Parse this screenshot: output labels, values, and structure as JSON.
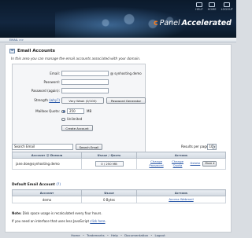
{
  "header": {
    "top_links": [
      {
        "label": "HELP",
        "icon": "help-icon"
      },
      {
        "label": "HOME",
        "icon": "home-icon"
      },
      {
        "label": "LOGOUT",
        "icon": "logout-icon"
      }
    ],
    "brand_mark": "c",
    "brand_name": "Panel",
    "brand_tagline": "Accelerated"
  },
  "breadcrumb": "EMAIL >>",
  "page": {
    "title": "Email Accounts",
    "intro": "In this area you can manage the email accounts associated with your domain."
  },
  "form": {
    "email_label": "Email:",
    "email_value": "",
    "domain_suffix": "@ synhosting.demo",
    "password_label": "Password:",
    "password_again_label": "Password (again):",
    "strength_label": "Strength",
    "strength_why": "(why?)",
    "strength_value": "Very Weak (0/100)",
    "generator_label": "Password Generator",
    "quota_label": "Mailbox Quota:",
    "quota_value": "250",
    "quota_unit": "MB",
    "unlimited_label": "Unlimited",
    "create_label": "Create Account"
  },
  "search": {
    "placeholder": "Search Email",
    "button_label": "Search Email",
    "rpp_label": "Results per page:",
    "rpp_value": "10"
  },
  "accounts_table": {
    "headers": {
      "account": "Account",
      "at": "@",
      "domain": "Domain",
      "usage": "Usage",
      "slash": "/",
      "quota": "Quota",
      "actions": "Actions"
    },
    "rows": [
      {
        "email": "jane.doe@synhosting.demo",
        "usage": "0 / 250 MB",
        "usage_fraction": 0,
        "change_password": "Change Password",
        "change_quota": "Change Quota",
        "delete": "Delete",
        "more": "More ▾"
      }
    ]
  },
  "default_account": {
    "title": "Default Email Account",
    "help": "(?)",
    "headers": {
      "account": "Account",
      "usage": "Usage",
      "actions": "Actions"
    },
    "row": {
      "account": "demo",
      "usage": "0 Bytes",
      "action": "Access Webmail"
    }
  },
  "notes": {
    "note_label": "Note:",
    "note_text": "Disk space usage is recalculated every four hours.",
    "js_prefix": "If you need an interface that uses less JavaScript",
    "js_link": "click here",
    "js_suffix": "."
  },
  "footer": {
    "links": [
      "Home",
      "Trademarks",
      "Help",
      "Documentation",
      "Logout"
    ]
  }
}
